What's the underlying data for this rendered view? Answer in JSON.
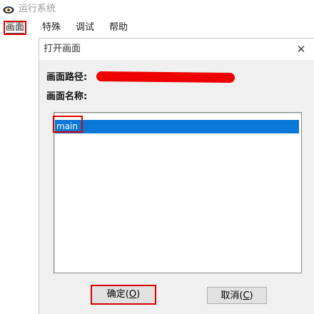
{
  "window": {
    "title": "运行系统",
    "icon": "eye-icon"
  },
  "menubar": {
    "items": [
      {
        "label": "画面"
      },
      {
        "label": "特殊"
      },
      {
        "label": "调试"
      },
      {
        "label": "帮助"
      }
    ]
  },
  "dialog": {
    "title": "打开画面",
    "close_glyph": "✕",
    "path_label": "画面路径:",
    "path_value_redacted": true,
    "name_label": "画面名称:",
    "list": {
      "items": [
        {
          "label": "main",
          "selected": true
        }
      ],
      "selection_color": "#0a78d7"
    },
    "ok_button": {
      "text": "确定(",
      "mnemonic": "O",
      "close": ")"
    },
    "cancel_button": {
      "text": "取消(",
      "mnemonic": "C",
      "close": ")"
    }
  },
  "annotation_color": "#e00000"
}
